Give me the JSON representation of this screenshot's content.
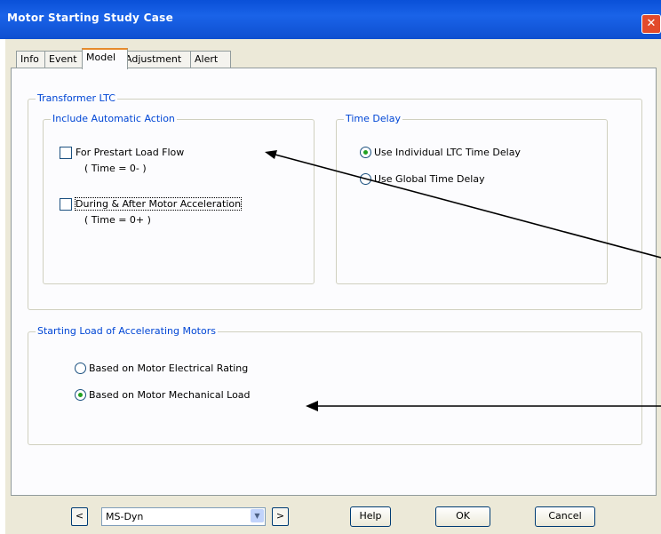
{
  "window": {
    "title": "Motor Starting Study Case",
    "close_glyph": "✕"
  },
  "tabs": [
    {
      "label": "Info",
      "active": false
    },
    {
      "label": "Event",
      "active": false
    },
    {
      "label": "Model",
      "active": true
    },
    {
      "label": "Adjustment",
      "active": false
    },
    {
      "label": "Alert",
      "active": false
    }
  ],
  "transformer_ltc": {
    "title": "Transformer LTC",
    "include_automatic_action": {
      "title": "Include Automatic Action",
      "prestart": {
        "label": "For Prestart Load Flow",
        "sub": "( Time = 0- )",
        "checked": false
      },
      "during_after": {
        "label": "During & After Motor Acceleration",
        "sub": "( Time = 0+ )",
        "checked": false
      }
    },
    "time_delay": {
      "title": "Time Delay",
      "individual": {
        "label": "Use Individual LTC Time Delay",
        "selected": true
      },
      "global": {
        "label": "Use Global Time Delay",
        "selected": false
      }
    }
  },
  "starting_load": {
    "title": "Starting Load of Accelerating Motors",
    "electrical": {
      "label": "Based on Motor Electrical Rating",
      "selected": false
    },
    "mechanical": {
      "label": "Based on Motor Mechanical Load",
      "selected": true
    }
  },
  "bottom": {
    "prev_label": "<",
    "next_label": ">",
    "study_case": "MS-Dyn",
    "help_label": "Help",
    "ok_label": "OK",
    "cancel_label": "Cancel"
  },
  "colors": {
    "titlebar": "#0a50d8",
    "group_title": "#0046d5",
    "dialog_bg": "#ece9d8",
    "radio_dot": "#21a121",
    "active_tab_accent": "#e68b2c"
  }
}
